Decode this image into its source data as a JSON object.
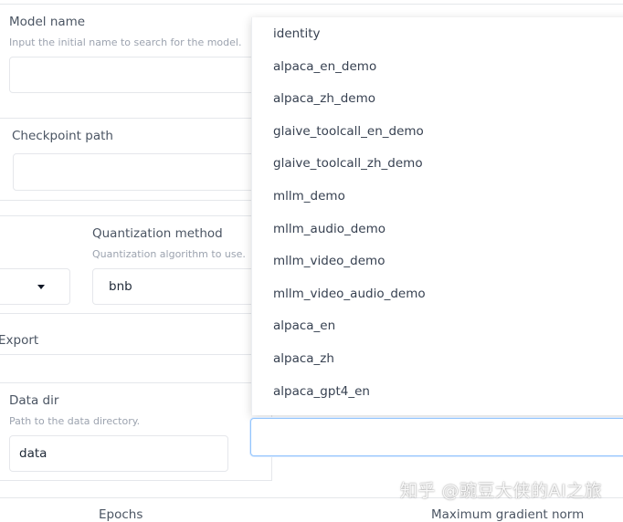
{
  "model_name": {
    "label": "Model name",
    "info": "Input the initial name to search for the model.",
    "value": ""
  },
  "checkpoint_path": {
    "label": "Checkpoint path",
    "value": ""
  },
  "quantization_method": {
    "label": "Quantization method",
    "info": "Quantization algorithm to use.",
    "value": "bnb"
  },
  "export_section": {
    "label": "Export"
  },
  "data_dir": {
    "label": "Data dir",
    "info": "Path to the data directory.",
    "value": "data"
  },
  "bottom_labels": {
    "epochs": "Epochs",
    "max_grad_norm": "Maximum gradient norm"
  },
  "dataset_dropdown": {
    "options": [
      "identity",
      "alpaca_en_demo",
      "alpaca_zh_demo",
      "glaive_toolcall_en_demo",
      "glaive_toolcall_zh_demo",
      "mllm_demo",
      "mllm_audio_demo",
      "mllm_video_demo",
      "mllm_video_audio_demo",
      "alpaca_en",
      "alpaca_zh",
      "alpaca_gpt4_en"
    ],
    "search_value": ""
  },
  "watermark": "知乎 @豌豆大侠的AI之旅",
  "icons": {
    "dropdown_caret": "chevron-down-icon"
  }
}
